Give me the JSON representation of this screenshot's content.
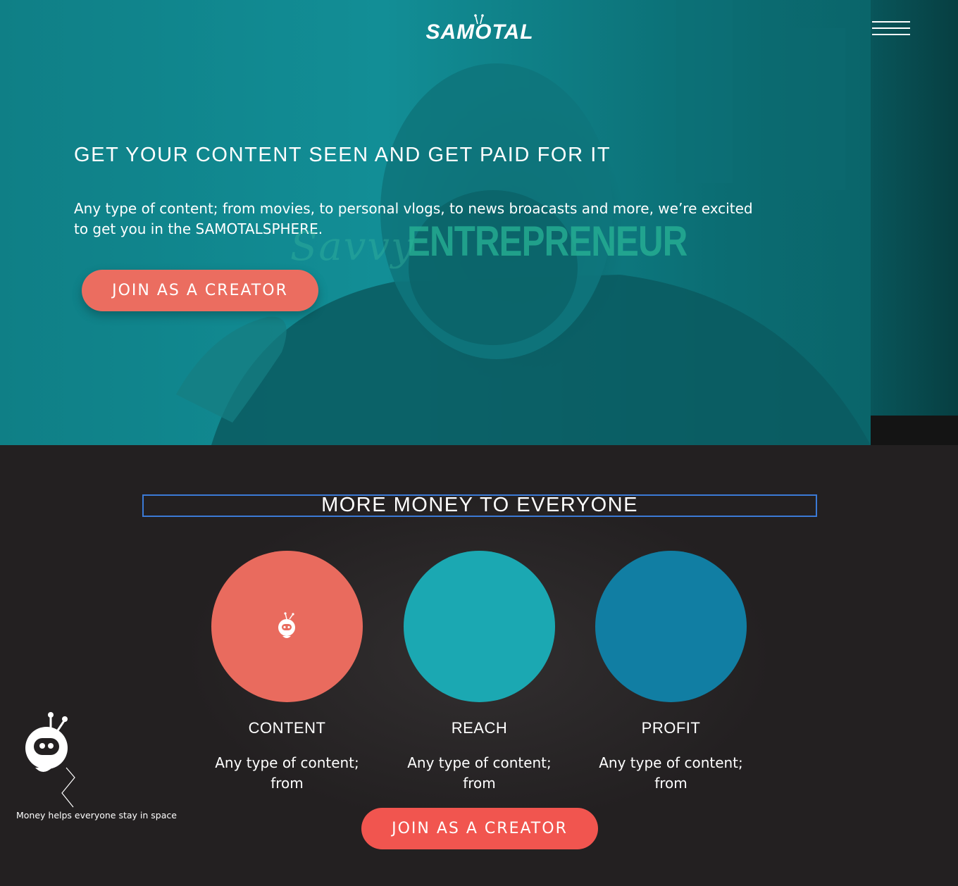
{
  "brand": {
    "logo_text": "SAMOTAL"
  },
  "header": {
    "menu_icon": "hamburger-icon"
  },
  "hero": {
    "heading": "GET YOUR CONTENT SEEN AND GET PAID FOR IT",
    "subtext": "Any type of content; from movies, to personal vlogs, to news broacasts and more, we’re excited to get you in the SAMOTALSPHERE.",
    "background_logo_script": "Savvy",
    "background_logo_bold": "ENTREPRENEUR",
    "cta_label": "JOIN AS A CREATOR"
  },
  "money": {
    "heading": "MORE MONEY TO EVERYONE",
    "features": [
      {
        "title": "CONTENT",
        "text": "Any type of content; from",
        "color": "#e96b5e",
        "icon": "robot-icon"
      },
      {
        "title": "REACH",
        "text": "Any type of content; from",
        "color": "#1ba8b2",
        "icon": ""
      },
      {
        "title": "PROFIT",
        "text": "Any type of content; from",
        "color": "#117ea3",
        "icon": ""
      }
    ],
    "cta_label": "JOIN AS A CREATOR",
    "mascot_caption": "Money helps everyone stay in space"
  },
  "colors": {
    "hero_teal": "#128e96",
    "cta_coral": "#eb6d60",
    "cta_red": "#f1554f",
    "section_dark": "#232021",
    "heading_outline": "#3b7ad6"
  }
}
